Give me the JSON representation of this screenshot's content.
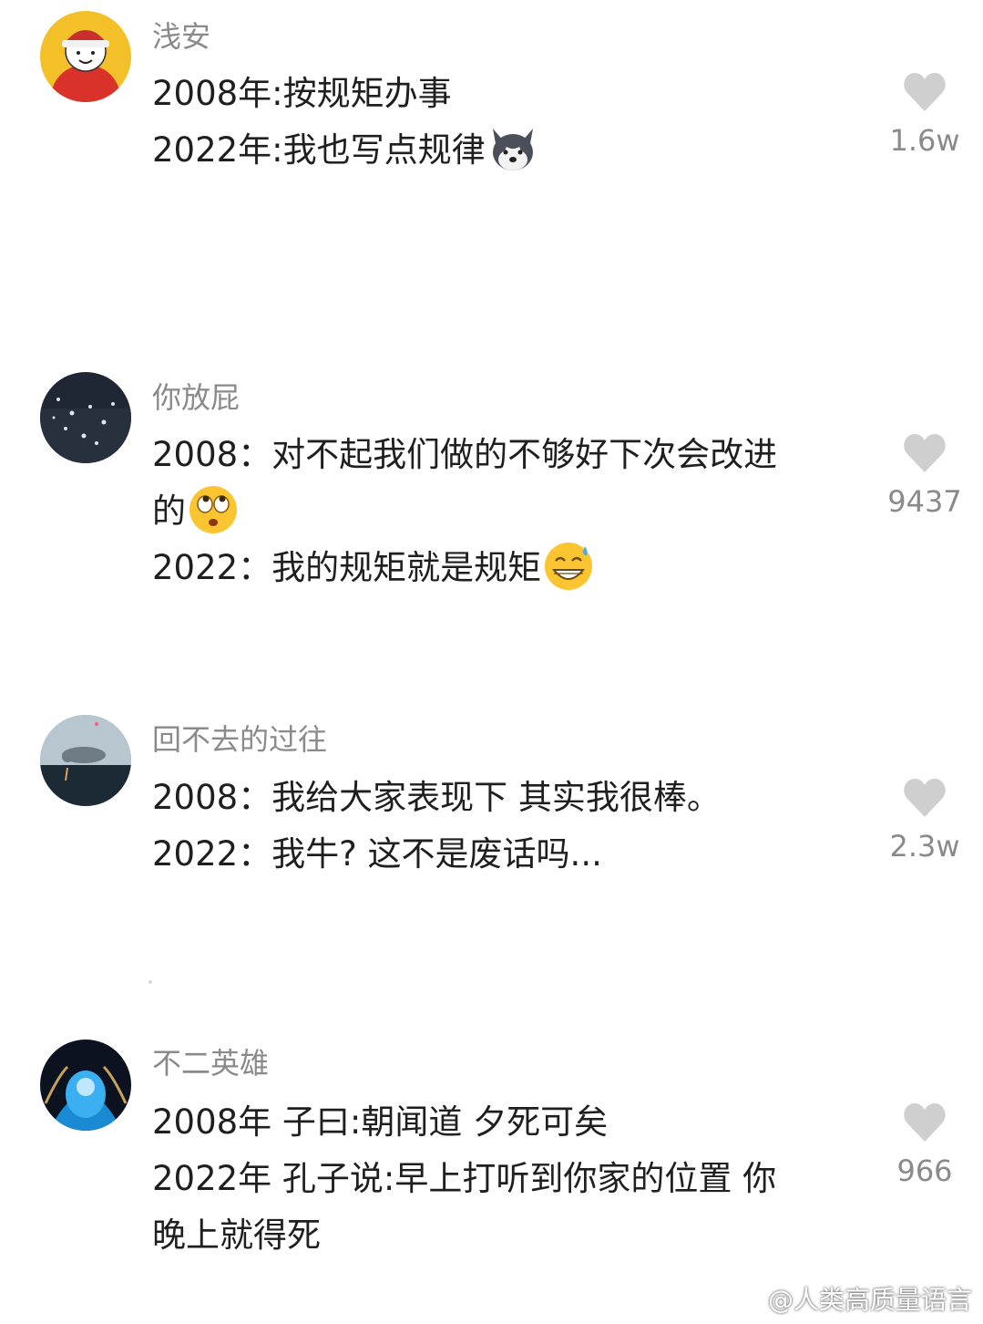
{
  "comments": [
    {
      "username": "浅安",
      "lines": [
        "2008年:按规矩办事",
        "2022年:我也写点规律"
      ],
      "likes": "1.6w",
      "emoji": "husky-dog-emoji"
    },
    {
      "username": "你放屁",
      "lines": [
        "2008：对不起我们做的不够好下次会改进",
        "的",
        "2022：我的规矩就是规矩"
      ],
      "likes": "9437",
      "emoji_1": "rolling-eyes-emoji",
      "emoji_2": "grin-sweat-emoji"
    },
    {
      "username": "回不去的过往",
      "lines": [
        "2008：我给大家表现下 其实我很棒。",
        "2022：我牛? 这不是废话吗..."
      ],
      "likes": "2.3w"
    },
    {
      "username": "不二英雄",
      "lines": [
        "2008年 子曰:朝闻道 夕死可矣",
        "2022年 孔子说:早上打听到你家的位置 你",
        "晚上就得死"
      ],
      "likes": "966"
    }
  ],
  "watermark": "@人类高质量语言",
  "colors": {
    "text": "#1f1f1f",
    "secondary": "#8a8a8a",
    "heart": "#cfcfcf"
  }
}
